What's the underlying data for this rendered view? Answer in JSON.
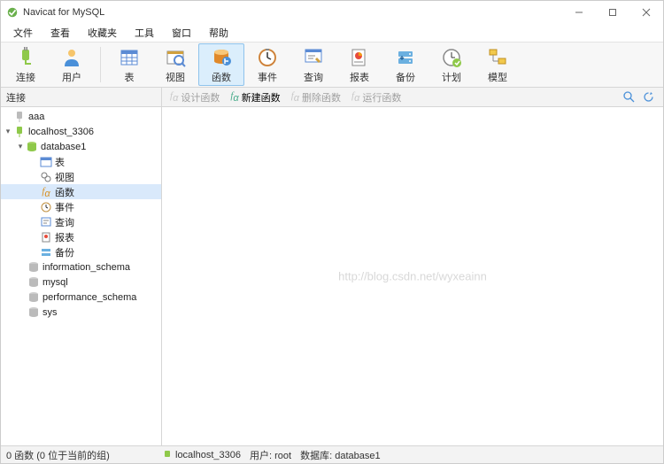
{
  "title": "Navicat for MySQL",
  "menus": [
    "文件",
    "查看",
    "收藏夹",
    "工具",
    "窗口",
    "帮助"
  ],
  "toolbar": {
    "conn": "连接",
    "user": "用户",
    "table": "表",
    "view": "视图",
    "func": "函数",
    "event": "事件",
    "query": "查询",
    "report": "报表",
    "backup": "备份",
    "plan": "计划",
    "model": "模型"
  },
  "sec_left": "连接",
  "sec_btns": {
    "design": "设计函数",
    "new": "新建函数",
    "del": "删除函数",
    "run": "运行函数"
  },
  "tree": {
    "aaa": "aaa",
    "local": "localhost_3306",
    "db1": "database1",
    "table": "表",
    "view": "视图",
    "func": "函数",
    "event": "事件",
    "query": "查询",
    "report": "报表",
    "backup": "备份",
    "info": "information_schema",
    "mysql": "mysql",
    "perf": "performance_schema",
    "sys": "sys"
  },
  "watermark": "http://blog.csdn.net/wyxeainn",
  "status": {
    "left": "0 函数 (0 位于当前的组)",
    "conn": "localhost_3306",
    "user": "用户: root",
    "db": "数据库: database1"
  }
}
